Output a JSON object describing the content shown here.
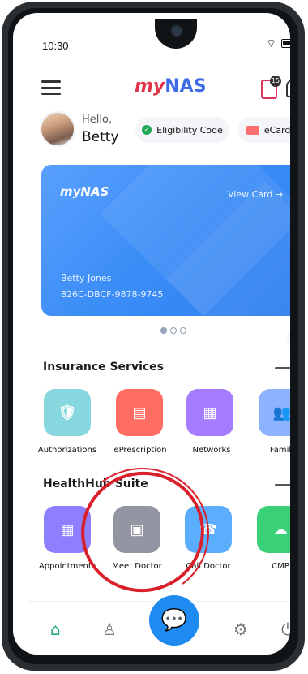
{
  "status": {
    "time": "10:30"
  },
  "header": {
    "logo_prefix": "my",
    "logo_suffix": "NAS",
    "doc_badge": "15",
    "bell_badge": "0"
  },
  "greeting": {
    "hello": "Hello,",
    "name": "Betty"
  },
  "chips": {
    "eligibility": "Eligibility Code",
    "ecards": "eCards"
  },
  "card": {
    "logo": "myNAS",
    "view": "View Card →",
    "holder": "Betty Jones",
    "id": "826C-DBCF-9878-9745"
  },
  "pager": {
    "current": 1,
    "total": 3
  },
  "sections": {
    "insurance": "Insurance Services",
    "healthhub": "HealthHub Suite"
  },
  "insurance_items": [
    {
      "label": "Authorizations",
      "icon": "shield-check-icon",
      "color": "#86d8de"
    },
    {
      "label": "ePrescription",
      "icon": "document-icon",
      "color": "#ff6d63"
    },
    {
      "label": "Networks",
      "icon": "building-icon",
      "color": "#a57bff"
    },
    {
      "label": "Family",
      "icon": "family-icon",
      "color": "#8fb2ff"
    }
  ],
  "healthhub_items": [
    {
      "label": "Appointments",
      "icon": "calendar-icon",
      "color": "#8d7fff"
    },
    {
      "label": "Meet Doctor",
      "icon": "video-icon",
      "color": "#9495a2"
    },
    {
      "label": "Call Doctor",
      "icon": "phone-icon",
      "color": "#5aaefd"
    },
    {
      "label": "CMP",
      "icon": "cloud-heart-icon",
      "color": "#39d078"
    }
  ],
  "bottom_nav": [
    "home-icon",
    "user-icon",
    "chat-icon",
    "settings-icon",
    "power-icon"
  ]
}
